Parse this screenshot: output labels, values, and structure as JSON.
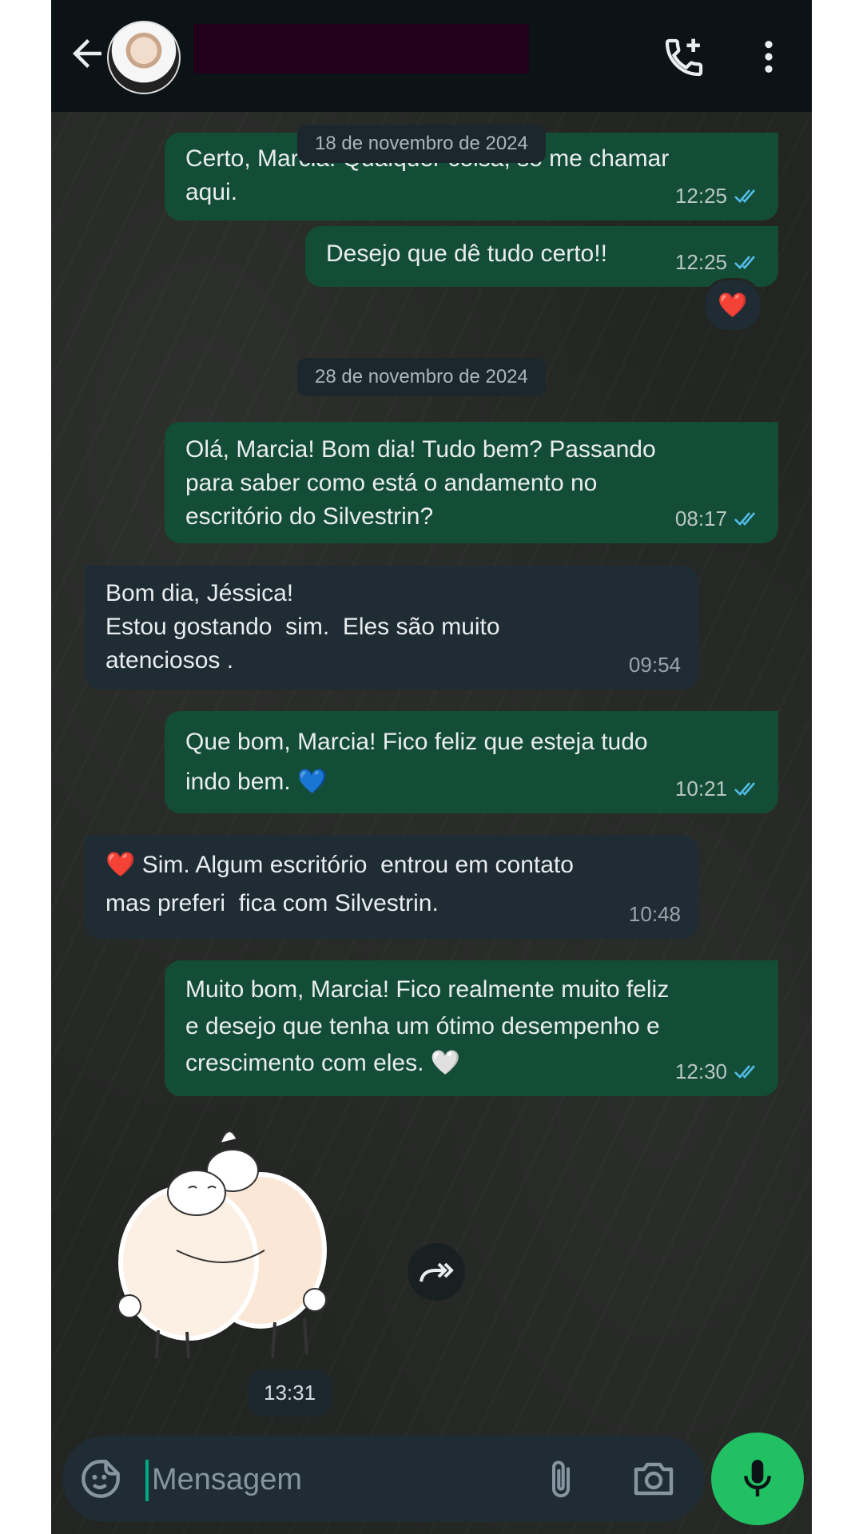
{
  "header": {
    "back_icon": "arrow-left-icon",
    "contact_name_redacted": true,
    "call_icon": "add-call-icon",
    "menu_icon": "more-vert-icon"
  },
  "dates": [
    "18 de novembro de 2024",
    "28 de novembro de 2024"
  ],
  "messages": [
    {
      "dir": "out",
      "text": "Certo, Marcia! Qualquer coisa, só me chamar\naqui.",
      "time": "12:25",
      "status": "read"
    },
    {
      "dir": "out",
      "text": "Desejo que dê tudo certo!!",
      "time": "12:25",
      "status": "read",
      "reaction": "❤️"
    },
    {
      "dir": "out",
      "text": "Olá, Marcia! Bom dia! Tudo bem? Passando\npara saber como está o andamento no\nescritório do Silvestrin?",
      "time": "08:17",
      "status": "read"
    },
    {
      "dir": "in",
      "text": "Bom dia, Jéssica!\nEstou gostando  sim.  Eles são muito\natenciosos .",
      "time": "09:54"
    },
    {
      "dir": "out",
      "text": "Que bom, Marcia! Fico feliz que esteja tudo\nindo bem. 💙",
      "time": "10:21",
      "status": "read"
    },
    {
      "dir": "in",
      "text": "❤️ Sim. Algum escritório  entrou em contato\nmas preferi  fica com Silvestrin.",
      "time": "10:48"
    },
    {
      "dir": "out",
      "text": "Muito bom, Marcia! Fico realmente muito feliz\ne desejo que tenha um ótimo desempenho e\ncrescimento com eles. 🤍",
      "time": "12:30",
      "status": "read"
    }
  ],
  "sticker": {
    "icon": "hugging-sheep-sticker",
    "time": "13:31"
  },
  "input": {
    "placeholder": "Mensagem",
    "emoji_icon": "sticker-icon",
    "attach_icon": "paperclip-icon",
    "camera_icon": "camera-icon",
    "mic_icon": "mic-icon"
  },
  "colors": {
    "outgoing_bubble": "#144d37",
    "incoming_bubble": "#1f2c34",
    "read_ticks": "#53bdeb",
    "mic_button": "#21c063",
    "header": "#0c1316"
  }
}
